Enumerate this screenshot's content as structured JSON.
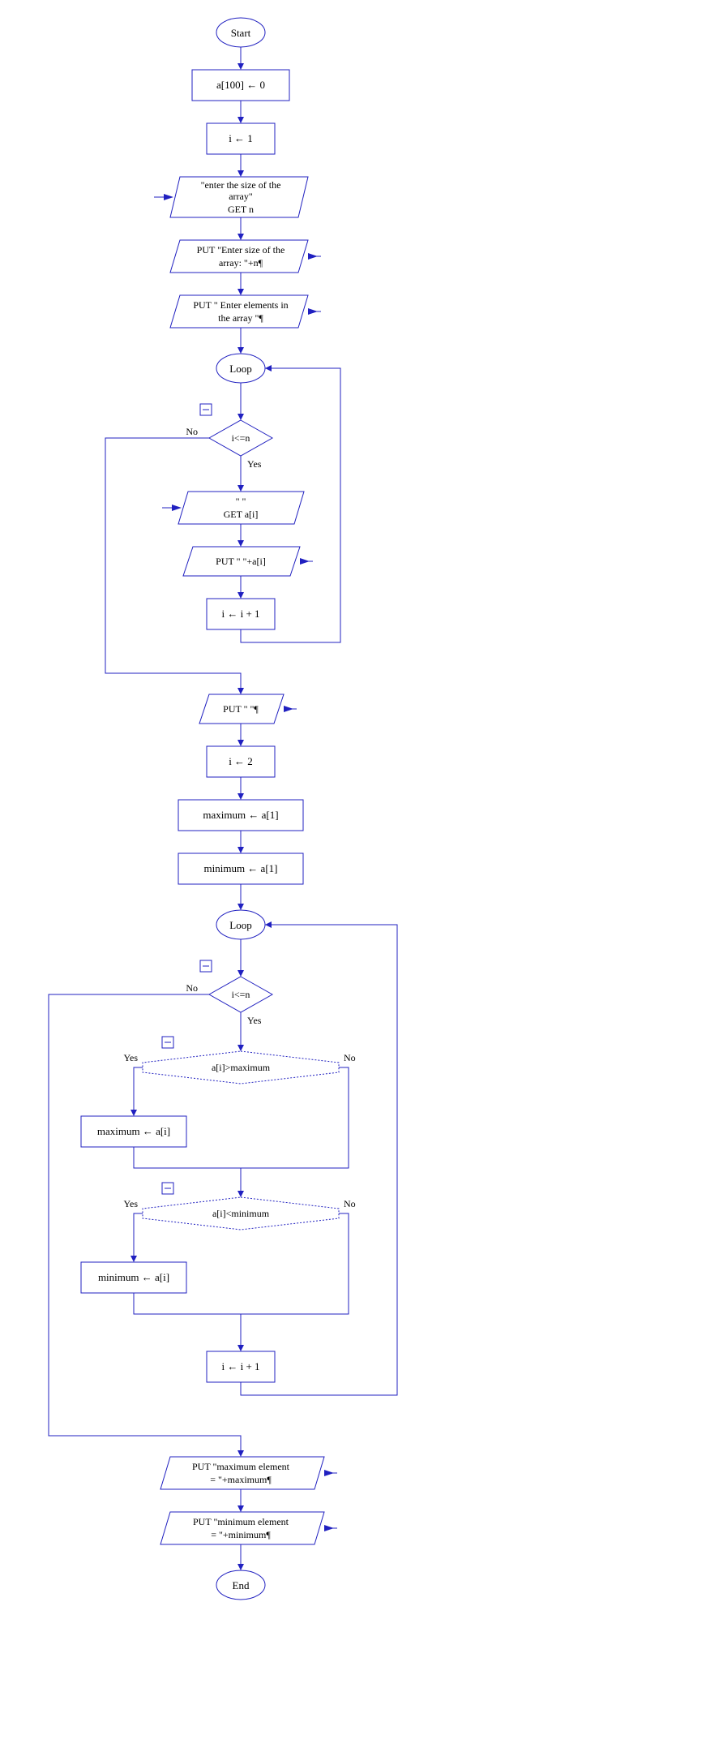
{
  "nodes": {
    "start": "Start",
    "init_array": "a[100] ← 0",
    "init_i1": "i ← 1",
    "prompt_size_l1": "\"enter the size of the",
    "prompt_size_l2": "array\"",
    "prompt_size_l3": "GET n",
    "put_size_l1": "PUT \"Enter size of the",
    "put_size_l2": "array: \"+n¶",
    "put_elems_l1": "PUT \"  Enter  elements in",
    "put_elems_l2": "the array \"¶",
    "loop1": "Loop",
    "cond1": "i<=n",
    "get_ai_l1": "\" \"",
    "get_ai_l2": "GET a[i]",
    "put_ai": "PUT \"  \"+a[i]",
    "inc_i1": "i ← i + 1",
    "put_blank": "PUT \" \"¶",
    "init_i2": "i ← 2",
    "init_max": "maximum ← a[1]",
    "init_min": "minimum ← a[1]",
    "loop2": "Loop",
    "cond2": "i<=n",
    "cond_max": "a[i]>maximum",
    "set_max": "maximum ← a[i]",
    "cond_min": "a[i]<minimum",
    "set_min": "minimum ← a[i]",
    "inc_i2": "i ← i + 1",
    "put_max_l1": "PUT \"maximum element",
    "put_max_l2": "=  \"+maximum¶",
    "put_min_l1": "PUT \"minimum element",
    "put_min_l2": "= \"+minimum¶",
    "end": "End"
  },
  "labels": {
    "yes": "Yes",
    "no": "No"
  },
  "break_glyph": "⊟"
}
